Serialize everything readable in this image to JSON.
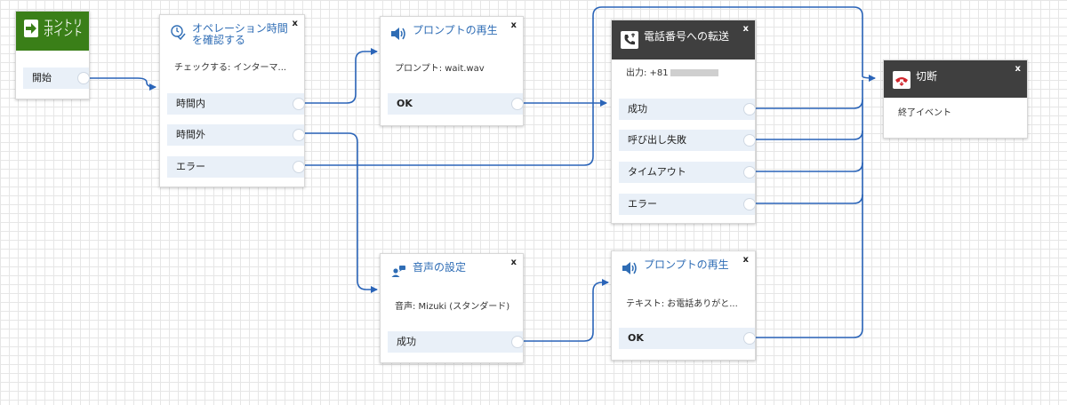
{
  "blocks": {
    "entry": {
      "title": "エントリポイント",
      "branches": [
        "開始"
      ],
      "icon": "arrow-right-icon"
    },
    "hours": {
      "title": "オペレーション時間を確認する",
      "info": "チェックする: インターマ...",
      "branches": [
        "時間内",
        "時間外",
        "エラー"
      ],
      "icon": "clock-check-icon",
      "close": "x"
    },
    "prompt1": {
      "title": "プロンプトの再生",
      "info": "プロンプト: wait.wav",
      "branches": [
        "OK"
      ],
      "icon": "speaker-icon",
      "close": "x"
    },
    "transfer": {
      "title": "電話番号への転送",
      "info": "出力: +81",
      "branches": [
        "成功",
        "呼び出し失敗",
        "タイムアウト",
        "エラー"
      ],
      "icon": "phone-transfer-icon",
      "close": "x"
    },
    "disconnect": {
      "title": "切断",
      "info": "終了イベント",
      "icon": "hangup-icon",
      "close": "x"
    },
    "voice": {
      "title": "音声の設定",
      "info": "音声: Mizuki (スタンダード)",
      "branches": [
        "成功"
      ],
      "icon": "voice-settings-icon",
      "close": "x"
    },
    "prompt2": {
      "title": "プロンプトの再生",
      "info": "テキスト: お電話ありがと...",
      "branches": [
        "OK"
      ],
      "icon": "speaker-icon",
      "close": "x"
    }
  },
  "colors": {
    "wire": "#2a64b8",
    "entry_header": "#3a7f18",
    "dark_header": "#3f3f3f",
    "title": "#2f6db5",
    "branch_bg": "#e9f0f8"
  }
}
